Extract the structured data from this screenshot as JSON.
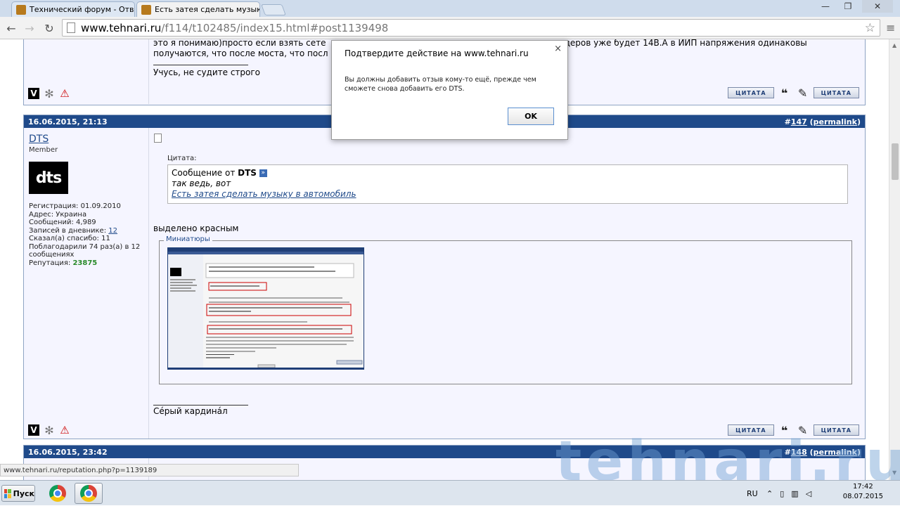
{
  "browser": {
    "tabs": [
      {
        "label": "Технический форум - Отве"
      },
      {
        "label": "Есть затея сделать музыку"
      }
    ],
    "window_buttons": {
      "minimize": "—",
      "maximize": "❐",
      "close": "✕"
    },
    "url_domain": "www.tehnari.ru",
    "url_path": "/f114/t102485/index15.html#post1139498",
    "status_url": "www.tehnari.ru/reputation.php?p=1139189"
  },
  "prev_post": {
    "text_line1": "это я понимаю)просто если взять сете",
    "text_line1_end": "после кондеров уже будет 14В.А в ИИП напряжения одинаковы",
    "text_line2": "получаются, что после моста, что посл",
    "signature": "Учусь, не судите строго"
  },
  "post147": {
    "date": "16.06.2015, 21:13",
    "number_prefix": "#",
    "number": "147",
    "permalink": "permalink",
    "author": "DTS",
    "rank": "Member",
    "avatar_text": "dts",
    "info": {
      "reg": "Регистрация: 01.09.2010",
      "address": "Адрес: Украина",
      "messages": "Сообщений: 4,989",
      "diary_label": "Записей в дневнике: ",
      "diary_count": "12",
      "thanked": "Сказал(а) спасибо: 11",
      "thanks_received": "Поблагодарили 74 раз(а) в 12 сообщениях",
      "rep_label": "Репутация: ",
      "rep_value": "23875"
    },
    "quote_label": "Цитата:",
    "quote_from": "Сообщение от ",
    "quote_author": "DTS",
    "quote_text": "так ведь, вот",
    "quote_link": "Есть затея сделать музыку в автомобиль",
    "body_text": "выделено красным",
    "thumbs_legend": "Миниатюры",
    "signature": "Сéрый кардинáл"
  },
  "post148": {
    "date": "16.06.2015, 23:42",
    "number_prefix": "#",
    "number": "148",
    "permalink": "permalink"
  },
  "buttons": {
    "quote": "ЦИТАТА",
    "multi_quote": "ЦИТАТА"
  },
  "dialog": {
    "title": "Подтвердите действие на www.tehnari.ru",
    "message": "Вы должны добавить отзыв кому-то ещё, прежде чем сможете снова добавить его DTS.",
    "ok": "OK"
  },
  "taskbar": {
    "start": "Пуск",
    "lang": "RU",
    "time": "17:42",
    "date": "08.07.2015"
  },
  "watermark": "tehnari.ru"
}
